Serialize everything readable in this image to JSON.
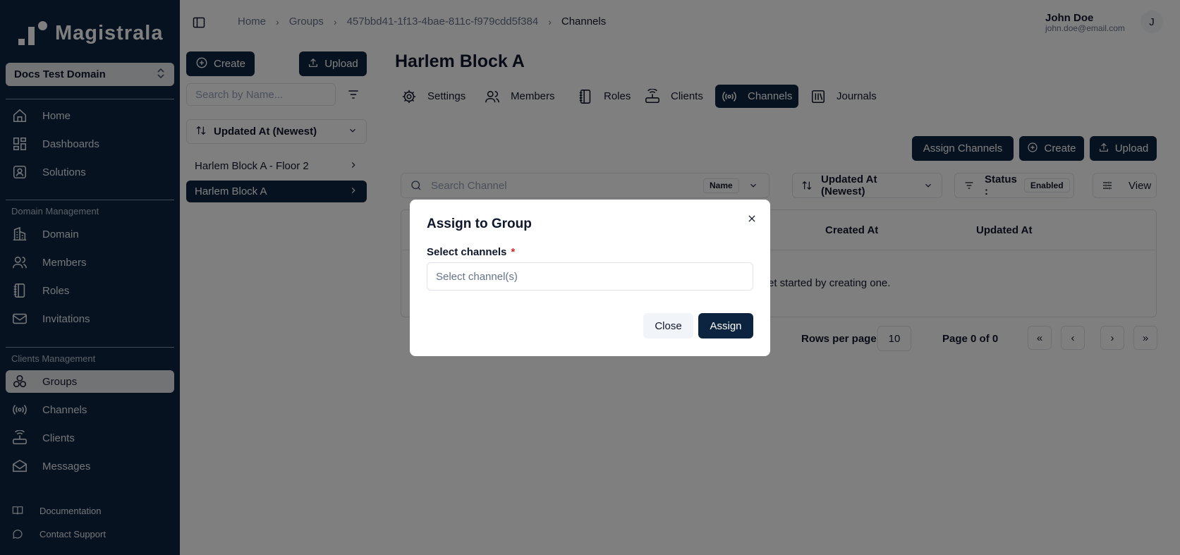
{
  "app": {
    "logo_text": "Magistrala",
    "domain": "Docs Test Domain"
  },
  "sidebar": {
    "items_top": [
      {
        "label": "Home",
        "icon": "home-icon"
      },
      {
        "label": "Dashboards",
        "icon": "dashboard-icon"
      },
      {
        "label": "Solutions",
        "icon": "solutions-icon"
      }
    ],
    "section_domain": "Domain Management",
    "items_domain": [
      {
        "label": "Domain",
        "icon": "building-icon"
      },
      {
        "label": "Members",
        "icon": "users-icon"
      },
      {
        "label": "Roles",
        "icon": "notebook-icon"
      },
      {
        "label": "Invitations",
        "icon": "mail-icon"
      }
    ],
    "section_clients": "Clients Management",
    "items_clients": [
      {
        "label": "Groups",
        "icon": "groups-icon"
      },
      {
        "label": "Channels",
        "icon": "radio-icon"
      },
      {
        "label": "Clients",
        "icon": "router-icon"
      },
      {
        "label": "Messages",
        "icon": "mail-open-icon"
      }
    ],
    "footer": [
      {
        "label": "Documentation",
        "icon": "book-icon"
      },
      {
        "label": "Contact Support",
        "icon": "chat-icon"
      }
    ]
  },
  "header": {
    "breadcrumb": [
      "Home",
      "Groups",
      "457bbd41-1f13-4bae-811c-f979cdd5f384",
      "Channels"
    ],
    "user_name": "John Doe",
    "user_email": "john.doe@email.com",
    "avatar_initial": "J"
  },
  "groups_panel": {
    "create_label": "Create",
    "upload_label": "Upload",
    "search_placeholder": "Search by Name...",
    "sort_label": "Updated At (Newest)",
    "items": [
      "Harlem Block A - Floor 2",
      "Harlem Block A"
    ]
  },
  "main": {
    "title": "Harlem Block A",
    "tabs": [
      "Settings",
      "Members",
      "Roles",
      "Clients",
      "Channels",
      "Journals"
    ],
    "actions": {
      "assign": "Assign Channels",
      "create": "Create",
      "upload": "Upload"
    },
    "search_placeholder": "Search Channel",
    "search_field_tag": "Name",
    "sort_label": "Updated At (Newest)",
    "status_label": "Status :",
    "status_value": "Enabled",
    "view_label": "View",
    "table_headers": [
      "Created At",
      "Updated At"
    ],
    "empty_text": "et started by creating one.",
    "rows_per_page_label": "Rows per page",
    "rows_per_page_value": "10",
    "page_label": "Page 0 of 0"
  },
  "modal": {
    "title": "Assign to Group",
    "field_label": "Select channels",
    "required_mark": "*",
    "field_placeholder": "Select channel(s)",
    "close_label": "Close",
    "assign_label": "Assign"
  },
  "colors": {
    "brand_navy": "#0d2440",
    "required": "#dc2626"
  }
}
